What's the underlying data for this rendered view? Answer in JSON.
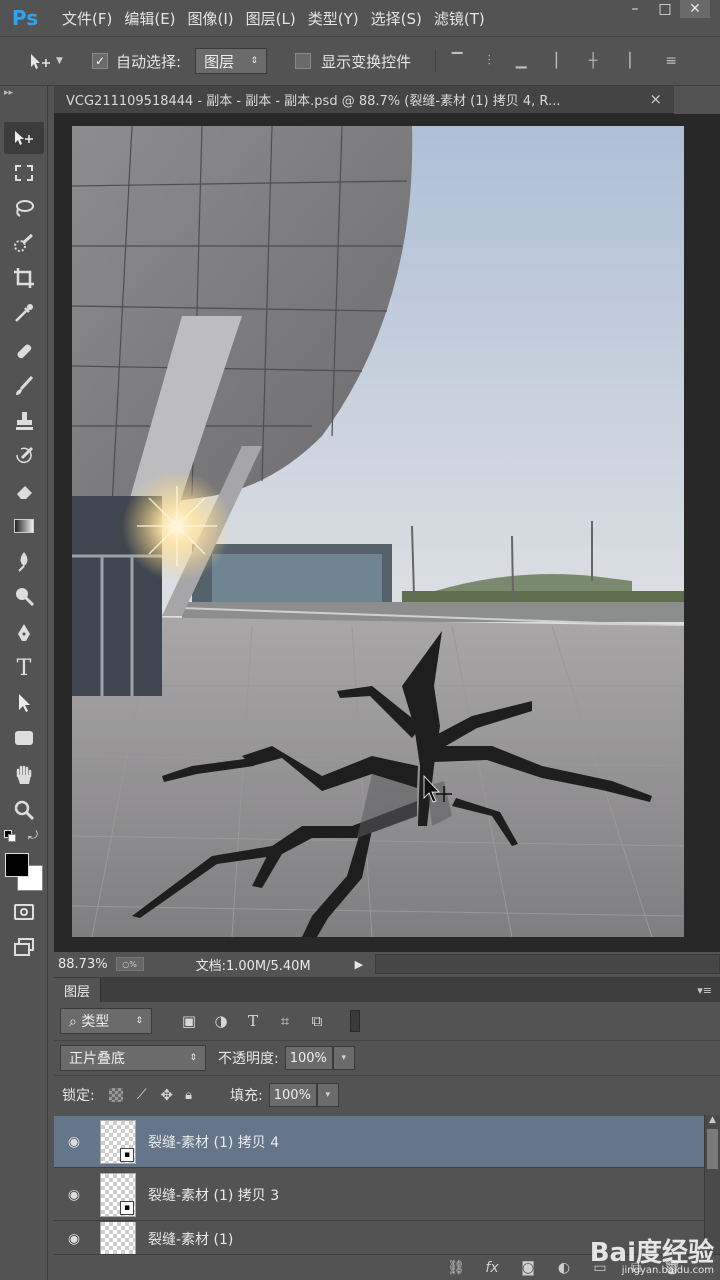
{
  "app": {
    "logo": "Ps"
  },
  "menu": [
    {
      "label": "文件(F)"
    },
    {
      "label": "编辑(E)"
    },
    {
      "label": "图像(I)"
    },
    {
      "label": "图层(L)"
    },
    {
      "label": "类型(Y)"
    },
    {
      "label": "选择(S)"
    },
    {
      "label": "滤镜(T)"
    }
  ],
  "window_controls": {
    "minimize": "–",
    "maximize": "□",
    "close": "✕"
  },
  "options_bar": {
    "move_tool_icon": "move-tool-icon",
    "auto_select_label": "自动选择:",
    "auto_select_checked": true,
    "auto_select_target": "图层",
    "show_transform_label": "显示变换控件",
    "show_transform_checked": false
  },
  "document": {
    "tab_title": "VCG211109518444 - 副本 - 副本 - 副本.psd @ 88.7% (裂缝-素材 (1) 拷贝 4, R...",
    "close": "×"
  },
  "status": {
    "zoom": "88.73%",
    "doc_size": "文档:1.00M/5.40M"
  },
  "layers_panel": {
    "tab": "图层",
    "filter_kind": "类型",
    "blend_mode": "正片叠底",
    "opacity_label": "不透明度:",
    "opacity_value": "100%",
    "lock_label": "锁定:",
    "fill_label": "填充:",
    "fill_value": "100%",
    "layers": [
      {
        "name": "裂缝-素材 (1) 拷贝 4",
        "visible": true,
        "selected": true
      },
      {
        "name": "裂缝-素材 (1) 拷贝 3",
        "visible": true,
        "selected": false
      },
      {
        "name": "裂缝-素材 (1)",
        "visible": true,
        "selected": false
      }
    ]
  },
  "watermark": {
    "brand": "Bai度经验",
    "url": "jingyan.baidu.com"
  },
  "colors": {
    "ui_bg": "#535353",
    "selected_layer": "#65758a",
    "ps_blue": "#2fa3f2",
    "canvas_bg": "#282828"
  }
}
